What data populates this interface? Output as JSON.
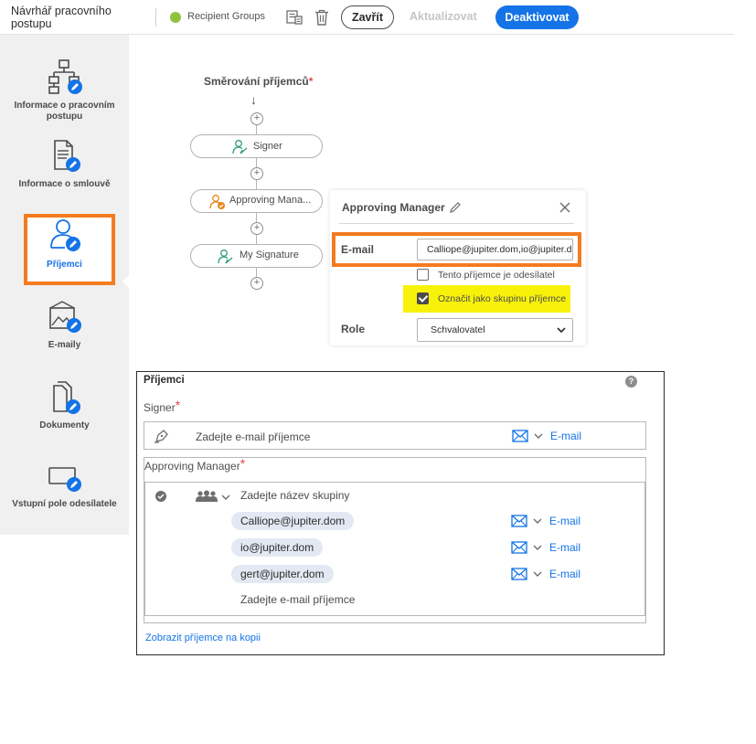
{
  "topbar": {
    "app_title": "Návrhář pracovního postupu",
    "group_label": "Recipient Groups",
    "close_label": "Zavřít",
    "update_label": "Aktualizovat",
    "deactivate_label": "Deaktivovat",
    "colors": {
      "accent": "#1473e6",
      "group_dot": "#8fc33d"
    }
  },
  "sidebar": {
    "items": [
      {
        "label": "Informace o pracovním postupu",
        "icon": "workflow-tree-icon"
      },
      {
        "label": "Informace o smlouvě",
        "icon": "document-edit-icon"
      },
      {
        "label": "Příjemci",
        "icon": "person-edit-icon",
        "active": true
      },
      {
        "label": "E-maily",
        "icon": "email-image-edit-icon"
      },
      {
        "label": "Dokumenty",
        "icon": "documents-edit-icon"
      },
      {
        "label": "Vstupní pole odesílatele",
        "icon": "sender-field-edit-icon"
      }
    ],
    "highlight_color": "#f47b20"
  },
  "routing": {
    "title": "Směrování příjemců",
    "required_mark": "*",
    "steps": [
      {
        "label": "Signer",
        "icon": "signer-person-icon",
        "color": "#2d9d78"
      },
      {
        "label": "Approving Mana...",
        "icon": "approver-person-icon",
        "color": "#e68619"
      },
      {
        "label": "My Signature",
        "icon": "signer-person-icon",
        "color": "#2d9d78"
      }
    ]
  },
  "detail_panel": {
    "title": "Approving Manager",
    "email_label": "E-mail",
    "email_value": "Calliope@jupiter.dom,io@jupiter.dom,gert@jupiter.dom",
    "checkbox_sender_label": "Tento příjemce je odesílatel",
    "checkbox_sender_checked": false,
    "checkbox_group_label": "Označit jako skupinu příjemce",
    "checkbox_group_checked": true,
    "role_label": "Role",
    "role_value": "Schvalovatel"
  },
  "recipients": {
    "title": "Příjemci",
    "help": "?",
    "signer_label": "Signer",
    "required_mark": "*",
    "signer_placeholder": "Zadejte e-mail příjemce",
    "email_option": "E-mail",
    "approving_label": "Approving Manager",
    "group_placeholder": "Zadejte název skupiny",
    "members": [
      "Calliope@jupiter.dom",
      "io@jupiter.dom",
      "gert@jupiter.dom"
    ],
    "member_placeholder": "Zadejte e-mail příjemce",
    "cc_link": "Zobrazit příjemce na kopii"
  }
}
